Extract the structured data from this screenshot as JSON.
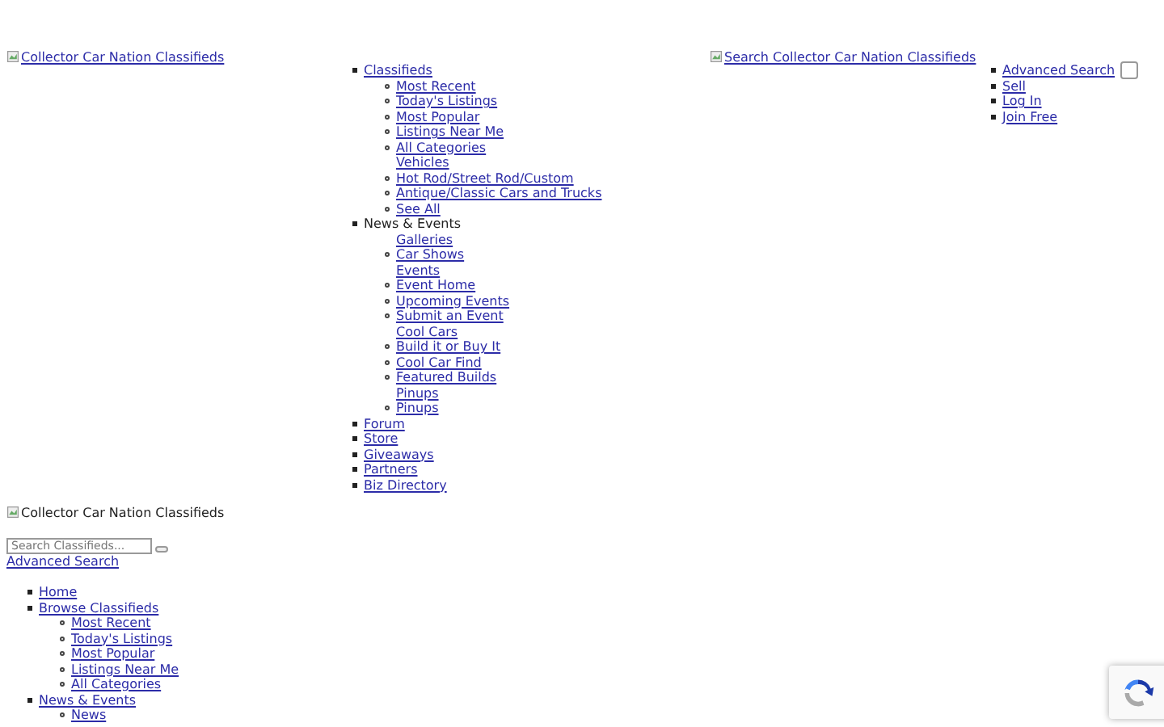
{
  "header": {
    "logo_alt": "Collector Car Nation Classifieds",
    "search_image_alt": "Search Collector Car Nation Classifieds"
  },
  "main_nav": [
    {
      "label": "Classifieds",
      "kind": "link",
      "children": [
        {
          "label": "Most Recent",
          "kind": "item"
        },
        {
          "label": "Today's Listings",
          "kind": "item"
        },
        {
          "label": "Most Popular",
          "kind": "item"
        },
        {
          "label": "Listings Near Me",
          "kind": "item"
        },
        {
          "label": "All Categories",
          "kind": "item"
        },
        {
          "label": "Vehicles",
          "kind": "label"
        },
        {
          "label": "Hot Rod/Street Rod/Custom",
          "kind": "item"
        },
        {
          "label": "Antique/Classic Cars and Trucks",
          "kind": "item"
        },
        {
          "label": "See All",
          "kind": "item"
        }
      ]
    },
    {
      "label": "News & Events",
      "kind": "text",
      "children": [
        {
          "label": "Galleries",
          "kind": "label"
        },
        {
          "label": "Car Shows",
          "kind": "item"
        },
        {
          "label": "Events",
          "kind": "label"
        },
        {
          "label": "Event Home",
          "kind": "item"
        },
        {
          "label": "Upcoming Events",
          "kind": "item"
        },
        {
          "label": "Submit an Event",
          "kind": "item"
        },
        {
          "label": "Cool Cars",
          "kind": "label"
        },
        {
          "label": "Build it or Buy It",
          "kind": "item"
        },
        {
          "label": "Cool Car Find",
          "kind": "item"
        },
        {
          "label": "Featured Builds",
          "kind": "item"
        },
        {
          "label": "Pinups",
          "kind": "label"
        },
        {
          "label": "Pinups",
          "kind": "item"
        }
      ]
    },
    {
      "label": "Forum",
      "kind": "link"
    },
    {
      "label": "Store",
      "kind": "link"
    },
    {
      "label": "Giveaways",
      "kind": "link"
    },
    {
      "label": "Partners",
      "kind": "link"
    },
    {
      "label": "Biz Directory",
      "kind": "link"
    }
  ],
  "account_links": [
    {
      "label": "Advanced Search"
    },
    {
      "label": "Sell"
    },
    {
      "label": "Log In"
    },
    {
      "label": "Join Free"
    }
  ],
  "toggle": {
    "checked": false
  },
  "mobile": {
    "logo_alt": "Collector Car Nation Classifieds",
    "search": {
      "placeholder": "Search Classifieds..."
    },
    "advanced_search": "Advanced Search",
    "nav": [
      {
        "label": "Home",
        "kind": "link"
      },
      {
        "label": "Browse Classifieds",
        "kind": "link",
        "children": [
          {
            "label": "Most Recent",
            "kind": "item"
          },
          {
            "label": "Today's Listings",
            "kind": "item"
          },
          {
            "label": "Most Popular",
            "kind": "item"
          },
          {
            "label": "Listings Near Me",
            "kind": "item"
          },
          {
            "label": "All Categories",
            "kind": "item"
          }
        ]
      },
      {
        "label": "News & Events",
        "kind": "link",
        "children": [
          {
            "label": "News",
            "kind": "item"
          }
        ]
      }
    ]
  }
}
